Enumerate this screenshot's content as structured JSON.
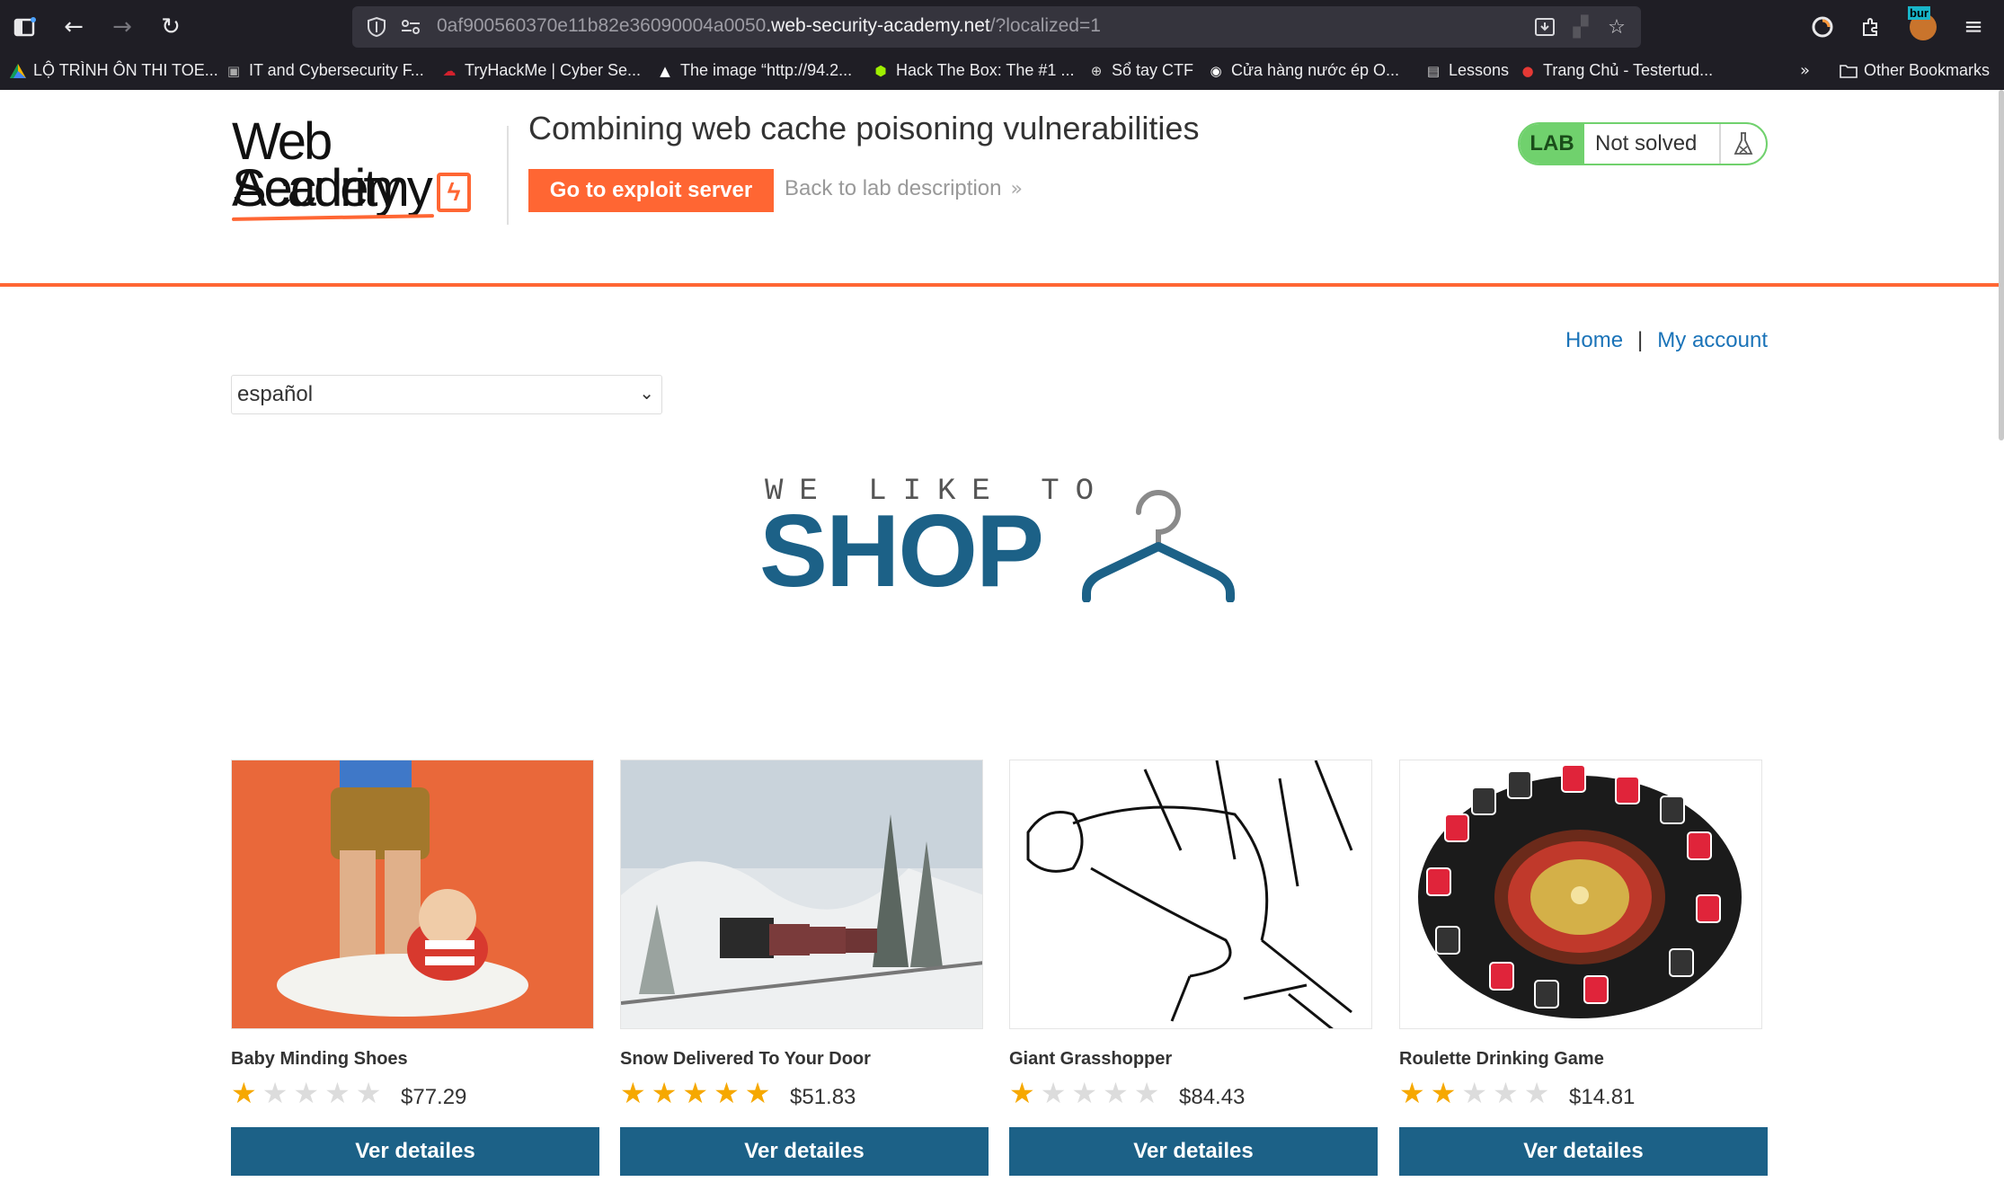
{
  "browser": {
    "url_prefix": "0af900560370e11b82e36090004a0050",
    "url_domain": ".web-security-academy.net",
    "url_suffix": "/?localized=1",
    "extension_badge": "bur",
    "bookmarks": [
      {
        "label": "LỘ TRÌNH ÔN THI TOE...",
        "icon": "triangle-icon"
      },
      {
        "label": "IT and Cybersecurity F...",
        "icon": "laptop-icon"
      },
      {
        "label": "TryHackMe | Cyber Se...",
        "icon": "cloud-icon"
      },
      {
        "label": "The image “http://94.2...",
        "icon": "mountain-icon"
      },
      {
        "label": "Hack The Box: The #1 ...",
        "icon": "cube-icon"
      },
      {
        "label": "Sổ tay CTF",
        "icon": "globe-icon"
      },
      {
        "label": "Cửa hàng nước ép O...",
        "icon": "leaf-icon"
      },
      {
        "label": "Lessons",
        "icon": "doc-icon"
      },
      {
        "label": "Trang Chủ - Testertud...",
        "icon": "pin-icon"
      }
    ],
    "other_bookmarks": "Other Bookmarks"
  },
  "header": {
    "logo_line1": "Web Security",
    "logo_line2": "Academy",
    "lab_title": "Combining web cache poisoning vulnerabilities",
    "exploit_button": "Go to exploit server",
    "back_link": "Back to lab description",
    "lab_label": "LAB",
    "lab_status": "Not solved"
  },
  "nav": {
    "home": "Home",
    "separator": "|",
    "account": "My account"
  },
  "language": {
    "selected": "español"
  },
  "hero": {
    "small": "WE LIKE TO",
    "big": "SHOP"
  },
  "products": [
    {
      "name": "Baby Minding Shoes",
      "rating": 1,
      "price": "$77.29",
      "button": "Ver detailes"
    },
    {
      "name": "Snow Delivered To Your Door",
      "rating": 5,
      "price": "$51.83",
      "button": "Ver detailes"
    },
    {
      "name": "Giant Grasshopper",
      "rating": 1,
      "price": "$84.43",
      "button": "Ver detailes"
    },
    {
      "name": "Roulette Drinking Game",
      "rating": 2,
      "price": "$14.81",
      "button": "Ver detailes"
    }
  ],
  "colors": {
    "accent": "#ff6633",
    "primary": "#1c6187",
    "lab_green": "#70d16d",
    "star": "#f6a800"
  }
}
